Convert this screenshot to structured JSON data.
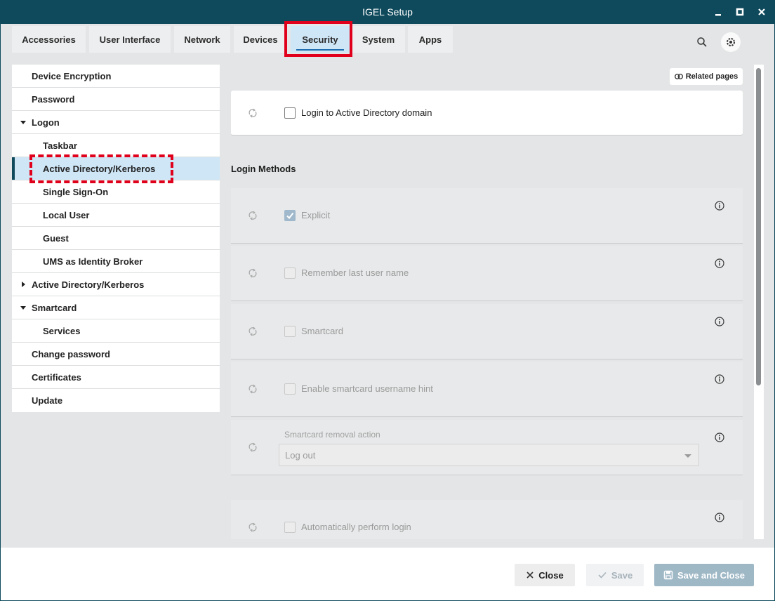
{
  "window": {
    "title": "IGEL Setup"
  },
  "tabs": [
    {
      "label": "Accessories"
    },
    {
      "label": "User Interface"
    },
    {
      "label": "Network"
    },
    {
      "label": "Devices"
    },
    {
      "label": "Security"
    },
    {
      "label": "System"
    },
    {
      "label": "Apps"
    }
  ],
  "sidebar": {
    "items": [
      {
        "label": "Device Encryption"
      },
      {
        "label": "Password"
      },
      {
        "label": "Logon"
      },
      {
        "label": "Taskbar"
      },
      {
        "label": "Active Directory/Kerberos"
      },
      {
        "label": "Single Sign-On"
      },
      {
        "label": "Local User"
      },
      {
        "label": "Guest"
      },
      {
        "label": "UMS as Identity Broker"
      },
      {
        "label": "Active Directory/Kerberos"
      },
      {
        "label": "Smartcard"
      },
      {
        "label": "Services"
      },
      {
        "label": "Change password"
      },
      {
        "label": "Certificates"
      },
      {
        "label": "Update"
      }
    ]
  },
  "content": {
    "related_pages": "Related pages",
    "login_ad": "Login to Active Directory domain",
    "section_title": "Login Methods",
    "options": {
      "explicit": "Explicit",
      "remember": "Remember last user name",
      "smartcard": "Smartcard",
      "smartcard_hint": "Enable smartcard username hint",
      "removal_caption": "Smartcard removal action",
      "removal_value": "Log out",
      "auto_login": "Automatically perform login"
    }
  },
  "footer": {
    "close": "Close",
    "save": "Save",
    "save_and_close": "Save and Close"
  },
  "colors": {
    "titlebar": "#0f4a5c",
    "selected_bg": "#cfe6f7",
    "highlight_red": "#e0001b"
  }
}
